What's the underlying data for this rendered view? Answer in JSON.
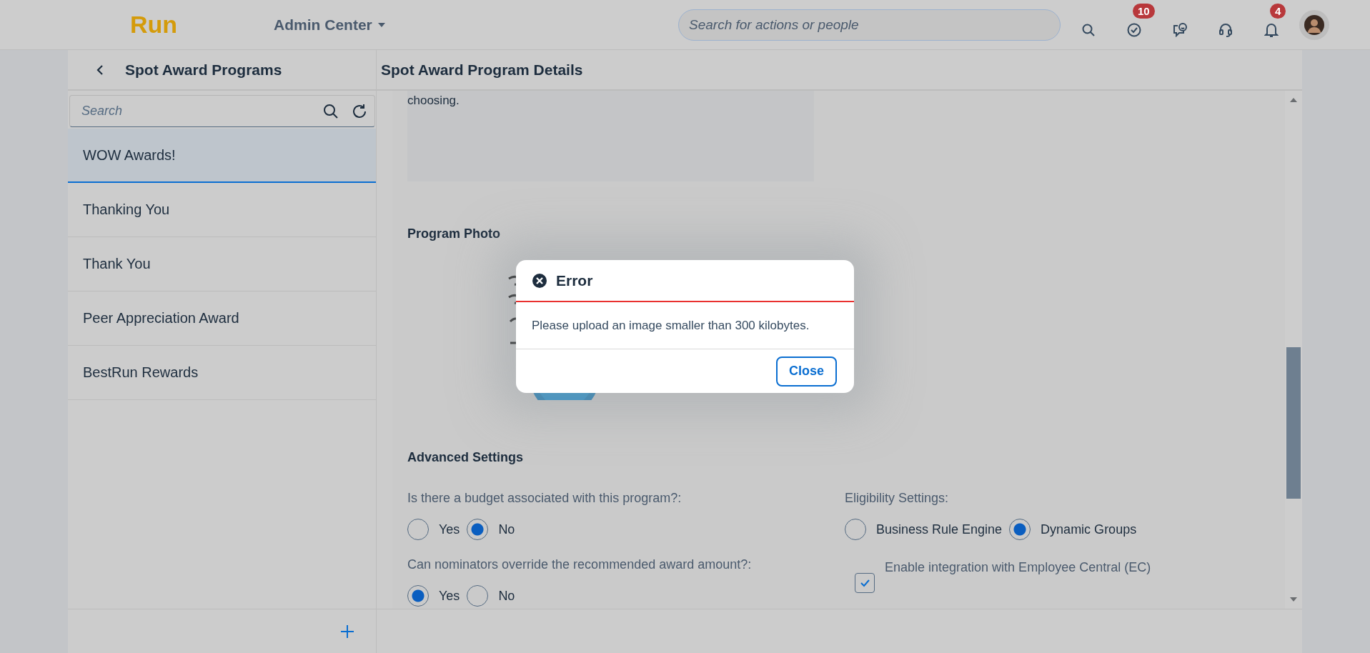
{
  "shell": {
    "logo": "Run",
    "menu": "Admin Center",
    "search": {
      "placeholder": "Search for actions or people"
    },
    "actions": [
      {
        "kind": "search"
      },
      {
        "kind": "tasks",
        "badge": "10"
      },
      {
        "kind": "chat"
      },
      {
        "kind": "support"
      },
      {
        "kind": "notifications",
        "badge": "4"
      },
      {
        "kind": "avatar"
      }
    ]
  },
  "list_panel": {
    "title": "Spot Award Programs",
    "search": {
      "placeholder": "Search"
    },
    "items": [
      {
        "label": "WOW Awards!",
        "selected": true
      },
      {
        "label": "Thanking You",
        "selected": false
      },
      {
        "label": "Thank You",
        "selected": false
      },
      {
        "label": "Peer Appreciation Award",
        "selected": false
      },
      {
        "label": "BestRun Rewards",
        "selected": false
      }
    ]
  },
  "details": {
    "title": "Spot Award Program Details",
    "description_tail": "choosing.",
    "photo_label": "Program Photo",
    "advanced_title": "Advanced Settings",
    "settings": [
      {
        "kind": "radio",
        "label": "Is there a budget associated with this program?:",
        "options": [
          {
            "label": "Yes",
            "selected": false
          },
          {
            "label": "No",
            "selected": true
          }
        ]
      },
      {
        "kind": "radio",
        "label": "Eligibility Settings:",
        "options": [
          {
            "label": "Business Rule Engine",
            "selected": false
          },
          {
            "label": "Dynamic Groups",
            "selected": true
          }
        ]
      },
      {
        "kind": "radio",
        "label": "Can nominators override the recommended award amount?:",
        "options": [
          {
            "label": "Yes",
            "selected": true
          },
          {
            "label": "No",
            "selected": false
          }
        ]
      },
      {
        "kind": "checkbox",
        "label": "Enable integration with Employee Central (EC)",
        "checked": true
      }
    ]
  },
  "dialog": {
    "title": "Error",
    "message": "Please upload an image smaller than 300 kilobytes.",
    "button": "Close"
  }
}
